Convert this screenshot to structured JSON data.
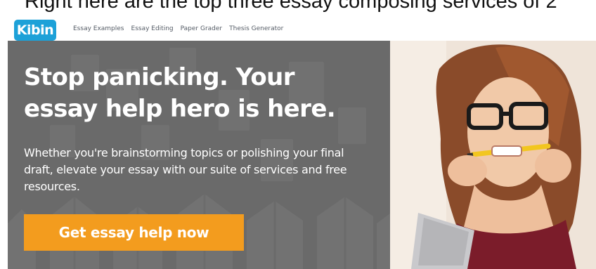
{
  "caption": "Right here are the top three essay composing services of 2",
  "brand": {
    "logo_text": "Kibin",
    "color": "#1da1d8"
  },
  "nav": {
    "items": [
      "Essay Examples",
      "Essay Editing",
      "Paper Grader",
      "Thesis Generator"
    ]
  },
  "hero": {
    "headline": "Stop panicking. Your essay help hero is here.",
    "subtext": "Whether you're brainstorming topics or polishing your final draft, elevate your essay with our suite of services and free resources.",
    "cta_label": "Get essay help now",
    "background_color": "#6a6a6a",
    "cta_color": "#f39c1e"
  },
  "photo": {
    "description_icon": "woman-with-pencil-photo"
  }
}
